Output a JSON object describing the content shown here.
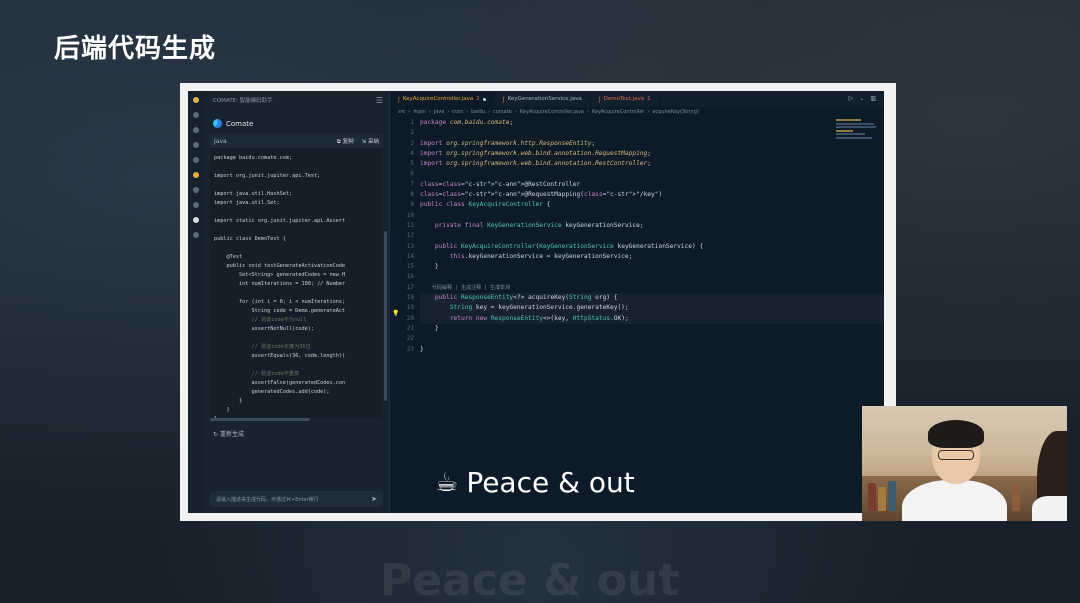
{
  "page_title": "后端代码生成",
  "caption": {
    "emoji": "☕",
    "text": "Peace & out"
  },
  "comate": {
    "header_title": "COMATE: 智能编码助手",
    "brand_name": "Comate",
    "code_language": "Java",
    "copy_label": "复制",
    "adopt_label": "采纳",
    "regenerate_label": "重新生成",
    "input_placeholder": "请输入描述来生成代码，可通过⌘+Enter换行",
    "code_lines": [
      "package baidu.comate.com;",
      "",
      "import org.junit.jupiter.api.Test;",
      "",
      "import java.util.HashSet;",
      "import java.util.Set;",
      "",
      "import static org.junit.jupiter.api.Assert",
      "",
      "public class DemoTest {",
      "",
      "    @Test",
      "    public void testGenerateActivationCode",
      "        Set<String> generatedCodes = new H",
      "        int numIterations = 100; // Number",
      "",
      "        for (int i = 0; i < numIterations;",
      "            String code = Demo.generateAct",
      "            // 验证code不为null",
      "            assertNotNull(code);",
      "",
      "            // 验证code长度为36位",
      "            assertEquals(36, code.length()",
      "",
      "            // 验证code不重复",
      "            assertFalse(generatedCodes.con",
      "            generatedCodes.add(code);",
      "        }",
      "    }",
      "}"
    ]
  },
  "editor": {
    "tabs": [
      {
        "label": "KeyAcquireController.java",
        "badge": "2",
        "active": true
      },
      {
        "label": "KeyGenerationService.java",
        "badge": "",
        "active": false
      },
      {
        "label": "DemoTest.java",
        "badge": "1",
        "active": false
      }
    ],
    "breadcrumb": [
      "src",
      "main",
      "java",
      "com",
      "baidu",
      "comate",
      "KeyAcquireController.java",
      "KeyAcquireController",
      "acquireKey(String)"
    ],
    "line_numbers": [
      "1",
      "2",
      "3",
      "4",
      "5",
      "6",
      "7",
      "8",
      "9",
      "10",
      "11",
      "12",
      "13",
      "14",
      "15",
      "16",
      "",
      "17",
      "18",
      "19",
      "20",
      "21",
      "22",
      "23"
    ],
    "codelens": "代码解释 | 生成注释 | 生成单测",
    "lines": [
      "package com.baidu.comate;",
      "",
      "import org.springframework.http.ResponseEntity;",
      "import org.springframework.web.bind.annotation.RequestMapping;",
      "import org.springframework.web.bind.annotation.RestController;",
      "",
      "@RestController",
      "@RequestMapping(\"/key\")",
      "public class KeyAcquireController {",
      "",
      "    private final KeyGenerationService keyGenerationService;",
      "",
      "    public KeyAcquireController(KeyGenerationService keyGenerationService) {",
      "        this.keyGenerationService = keyGenerationService;",
      "    }",
      "",
      "    public ResponseEntity<?> acquireKey(String org) {",
      "        String key = keyGenerationService.generateKey();",
      "        return new ResponseEntity<>(key, HttpStatus.OK);",
      "    }",
      "",
      "}",
      ""
    ]
  },
  "colors": {
    "accent": "#e8a23a",
    "keyword": "#c586c0",
    "type": "#4ec9b0",
    "annotation": "#d7ba7d"
  }
}
